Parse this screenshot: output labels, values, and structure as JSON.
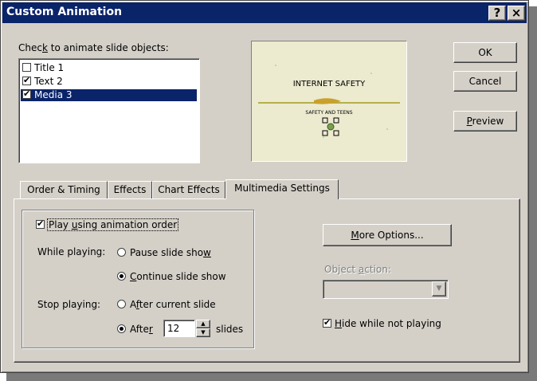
{
  "window": {
    "title": "Custom Animation",
    "help_label": "?",
    "close_label": "×"
  },
  "objects": {
    "label_pre": "Chec",
    "label_key": "k",
    "label_post": " to animate slide objects:",
    "items": [
      {
        "label": "Title 1",
        "checked": false,
        "selected": false
      },
      {
        "label": "Text 2",
        "checked": true,
        "selected": false
      },
      {
        "label": "Media 3",
        "checked": true,
        "selected": true
      }
    ]
  },
  "preview": {
    "heading": "INTERNET SAFETY",
    "subheading": "SAFETY AND TEENS"
  },
  "buttons": {
    "ok": "OK",
    "cancel": "Cancel",
    "preview_pre": "",
    "preview_key": "P",
    "preview_post": "review"
  },
  "tabs": [
    {
      "label": "Order & Timing",
      "active": false
    },
    {
      "label": "Effects",
      "active": false
    },
    {
      "label": "Chart Effects",
      "active": false
    },
    {
      "label": "Multimedia Settings",
      "active": true
    }
  ],
  "multimedia": {
    "play_pre": "Play ",
    "play_key": "u",
    "play_post": "sing animation order",
    "play_checked": true,
    "while_playing_label": "While playing:",
    "pause_pre": "Pause slide sho",
    "pause_key": "w",
    "pause_post": "",
    "continue_pre": "",
    "continue_key": "C",
    "continue_post": "ontinue slide show",
    "while_selected": "continue",
    "stop_playing_label": "Stop playing:",
    "after_current_pre": "A",
    "after_current_key": "f",
    "after_current_post": "ter current slide",
    "after_pre": "Afte",
    "after_key": "r",
    "after_post": "",
    "stop_selected": "after",
    "after_value": "12",
    "slides_label": "slides",
    "more_options_pre": "",
    "more_options_key": "M",
    "more_options_post": "ore Options...",
    "object_action_pre": "Object ",
    "object_action_key": "a",
    "object_action_post": "ction:",
    "object_action_value": "",
    "hide_pre": "",
    "hide_key": "H",
    "hide_post": "ide while not playing",
    "hide_checked": true
  }
}
